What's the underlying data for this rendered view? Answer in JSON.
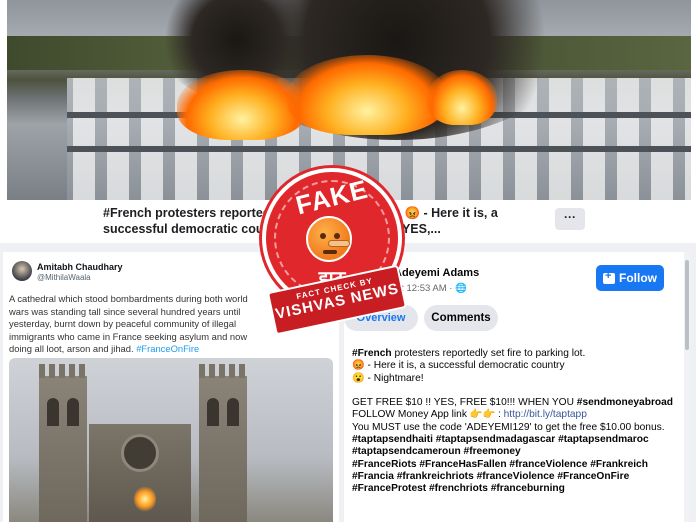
{
  "top_post": {
    "caption": "#French protesters reported set fire to parking lot. 😡 - Here it is, a successful democratic country... GET FREE $10 !! YES,...",
    "more_label": "···"
  },
  "tweet": {
    "author": "Amitabh Chaudhary",
    "handle": "@MithilaWaala",
    "text": "A cathedral which stood bombardments during both world wars was standing tall since several hundred years until yesterday, burnt down by peaceful community of illegal immigrants who came in France seeking asylum and now doing all loot, arson and jihad.",
    "hashtag": "#FranceOnFire"
  },
  "fb_post": {
    "author": "Adeyemi Adams",
    "time": "3 at 12:53 AM · 🌐",
    "follow_label": "Follow",
    "tab_overview": "Overview",
    "tab_comments": "Comments",
    "lines": [
      {
        "hashtag": "#French",
        "text": " protesters reportedly set fire to parking lot."
      },
      {
        "text": "😡 - Here it is, a successful democratic country"
      },
      {
        "text": "😮 - Nightmare!"
      },
      {
        "text": ""
      },
      {
        "text": "GET FREE $10 !! YES, FREE $10!!! WHEN YOU ",
        "hashtag": "#sendmoneyabroad"
      },
      {
        "text": "FOLLOW Money App link 👉👉 : ",
        "link": "http://bit.ly/taptapp"
      },
      {
        "text": "You MUST use the code 'ADEYEMI129' to get the free $10.00 bonus."
      },
      {
        "hashtag": "#taptapsendhaiti #taptapsendmadagascar #taptapsendmaroc"
      },
      {
        "hashtag": "#taptapsendcameroun #freemoney"
      },
      {
        "hashtag": "#FranceRiots #FranceHasFallen #franceViolence #Frankreich"
      },
      {
        "hashtag": "#Francia #frankreichriots #franceViolence #FranceOnFire"
      },
      {
        "hashtag": "#FranceProtest #frenchriots #franceburning"
      }
    ]
  },
  "stamp": {
    "word": "FAKE",
    "hindi": "झूठ",
    "banner_top": "FACT CHECK BY",
    "banner_main": "VISHVAS NEWS"
  },
  "colors": {
    "facebook_blue": "#1877f2",
    "twitter_blue": "#1d9bf0",
    "stamp_red": "#e0272b"
  }
}
